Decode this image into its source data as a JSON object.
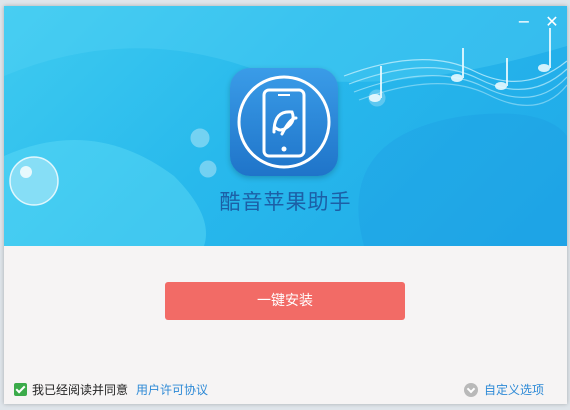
{
  "window": {
    "minimize_label": "−",
    "close_label": "✕"
  },
  "app": {
    "name": "酷音苹果助手",
    "logo_icon": "phone-music-icon"
  },
  "install": {
    "button_label": "一键安装"
  },
  "footer": {
    "agree_checked": true,
    "agree_text": "我已经阅读并同意",
    "license_link": "用户许可协议",
    "custom_label": "自定义选项"
  },
  "colors": {
    "banner": "#28b9ec",
    "install_button": "#f26b66",
    "link": "#2e8ad6",
    "app_name": "#1c5fa6"
  }
}
